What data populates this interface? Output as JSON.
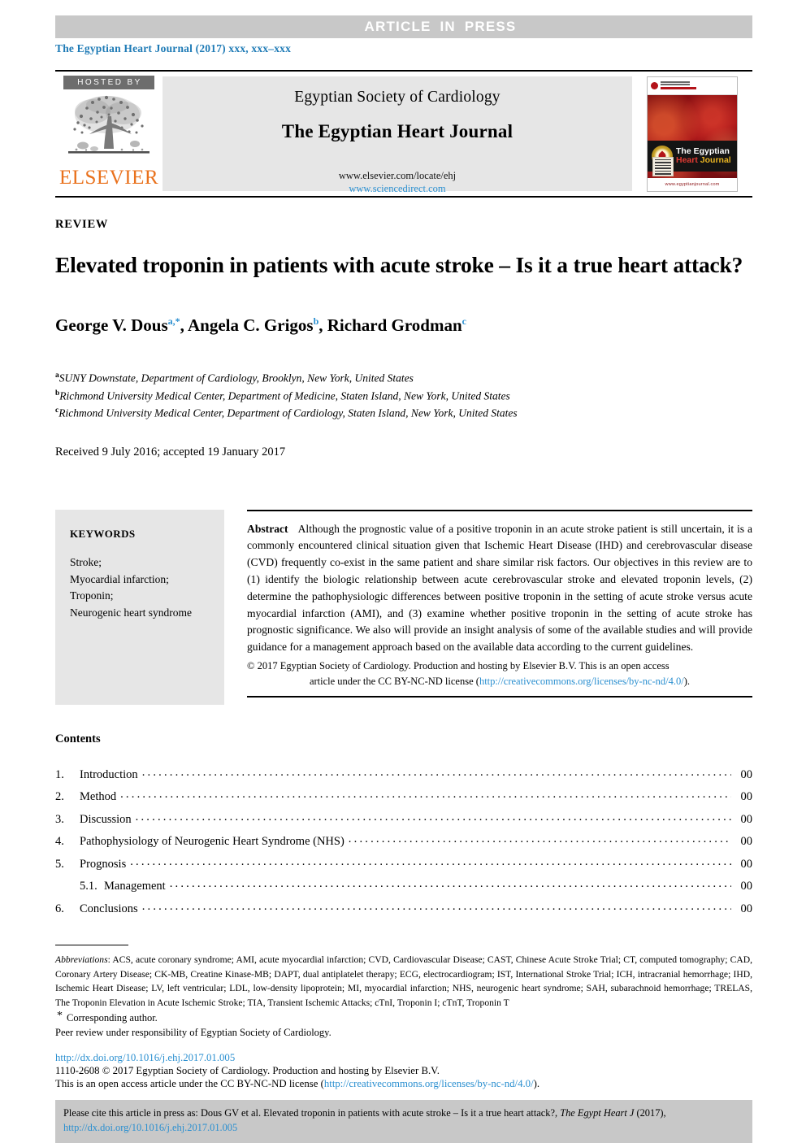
{
  "banner": {
    "label": "ARTICLE  IN  PRESS"
  },
  "journal_line": "The Egyptian Heart Journal (2017) xxx, xxx–xxx",
  "masthead": {
    "hosted_by": "HOSTED BY",
    "publisher": "ELSEVIER",
    "society": "Egyptian Society of Cardiology",
    "journal_title": "The Egyptian Heart Journal",
    "url_elsevier": "www.elsevier.com/locate/ehj",
    "url_sciencedirect": "www.sciencedirect.com",
    "cover": {
      "society_line": "EGYPTIAN SOCIETY OF CARDIOLOGY",
      "official_line": "OFFICIAL JOURNAL",
      "title_line1": "The Egyptian",
      "title_line2_a": "Heart",
      "title_line2_b": "Journal",
      "footer_url": "www.egyptianjournal.com"
    }
  },
  "article": {
    "kicker": "REVIEW",
    "title": "Elevated troponin in patients with acute stroke – Is it a true heart attack?",
    "authors": [
      {
        "name": "George V. Dous",
        "marks": "a,*"
      },
      {
        "name": "Angela C. Grigos",
        "marks": "b"
      },
      {
        "name": "Richard Grodman",
        "marks": "c"
      }
    ],
    "affiliations": [
      {
        "mark": "a",
        "text": "SUNY Downstate, Department of Cardiology, Brooklyn, New York, United States"
      },
      {
        "mark": "b",
        "text": "Richmond University Medical Center, Department of Medicine, Staten Island, New York, United States"
      },
      {
        "mark": "c",
        "text": "Richmond University Medical Center, Department of Cardiology, Staten Island, New York, United States"
      }
    ],
    "dates": "Received 9 July 2016; accepted 19 January 2017"
  },
  "keywords": {
    "heading": "KEYWORDS",
    "items": "Stroke;\nMyocardial infarction;\nTroponin;\nNeurogenic heart syndrome"
  },
  "abstract": {
    "label": "Abstract",
    "text": "Although the prognostic value of a positive troponin in an acute stroke patient is still uncertain, it is a commonly encountered clinical situation given that Ischemic Heart Disease (IHD) and cerebrovascular disease (CVD) frequently co-exist in the same patient and share similar risk factors. Our objectives in this review are to (1) identify the biologic relationship between acute cerebrovascular stroke and elevated troponin levels, (2) determine the pathophysiologic differences between positive troponin in the setting of acute stroke versus acute myocardial infarction (AMI), and (3) examine whether positive troponin in the setting of acute stroke has prognostic significance. We also will provide an insight analysis of some of the available studies and will provide guidance for a management approach based on the available data according to the current guidelines.",
    "copyright_line1": "© 2017 Egyptian Society of Cardiology. Production and hosting by Elsevier B.V. This is an open access",
    "copyright_line2_pre": "article under the CC BY-NC-ND license (",
    "copyright_link": "http://creativecommons.org/licenses/by-nc-nd/4.0/",
    "copyright_line2_post": ")."
  },
  "contents": {
    "heading": "Contents",
    "rows": [
      {
        "num": "1.",
        "label": "Introduction",
        "page": "00",
        "sub": false
      },
      {
        "num": "2.",
        "label": "Method",
        "page": "00",
        "sub": false
      },
      {
        "num": "3.",
        "label": "Discussion",
        "page": "00",
        "sub": false
      },
      {
        "num": "4.",
        "label": "Pathophysiology of Neurogenic Heart Syndrome (NHS)",
        "page": "00",
        "sub": false
      },
      {
        "num": "5.",
        "label": "Prognosis",
        "page": "00",
        "sub": false
      },
      {
        "num": "5.1.",
        "label": "Management",
        "page": "00",
        "sub": true
      },
      {
        "num": "6.",
        "label": "Conclusions",
        "page": "00",
        "sub": false
      }
    ],
    "dots": "........................................................................................................................................................................................"
  },
  "footnotes": {
    "abbrev_label": "Abbreviations",
    "abbrev_text": ": ACS, acute coronary syndrome; AMI, acute myocardial infarction; CVD, Cardiovascular Disease; CAST, Chinese Acute Stroke Trial; CT, computed tomography; CAD, Coronary Artery Disease; CK-MB, Creatine Kinase-MB; DAPT, dual antiplatelet therapy; ECG, electrocardiogram; IST, International Stroke Trial; ICH, intracranial hemorrhage; IHD, Ischemic Heart Disease; LV, left ventricular; LDL, low-density lipoprotein; MI, myocardial infarction; NHS, neurogenic heart syndrome; SAH, subarachnoid hemorrhage; TRELAS, The Troponin Elevation in Acute Ischemic Stroke; TIA, Transient Ischemic Attacks; cTnI, Troponin I; cTnT, Troponin T",
    "corresponding": "Corresponding author.",
    "peer_review": "Peer review under responsibility of Egyptian Society of Cardiology.",
    "doi": "http://dx.doi.org/10.1016/j.ehj.2017.01.005",
    "issn_line": "1110-2608 © 2017 Egyptian Society of Cardiology. Production and hosting by Elsevier B.V.",
    "oa_pre": "This is an open access article under the CC BY-NC-ND license (",
    "oa_link": "http://creativecommons.org/licenses/by-nc-nd/4.0/",
    "oa_post": ")."
  },
  "citation": {
    "pre": "Please cite this article in press as: Dous GV et al. Elevated troponin in patients with acute stroke – Is it a true heart attack?, ",
    "italic": "The Egypt Heart J",
    "mid": " (2017), ",
    "link": "http://dx.doi.org/10.1016/j.ehj.2017.01.005"
  },
  "colors": {
    "banner_gray": "#c8c8c8",
    "link_blue": "#2a8fd0",
    "journal_blue": "#1f7bb6",
    "elsevier_orange": "#E9711C",
    "masthead_gray": "#e6e6e6",
    "hosted_badge_gray": "#6d6d6d",
    "cover_red": "#a81418"
  }
}
